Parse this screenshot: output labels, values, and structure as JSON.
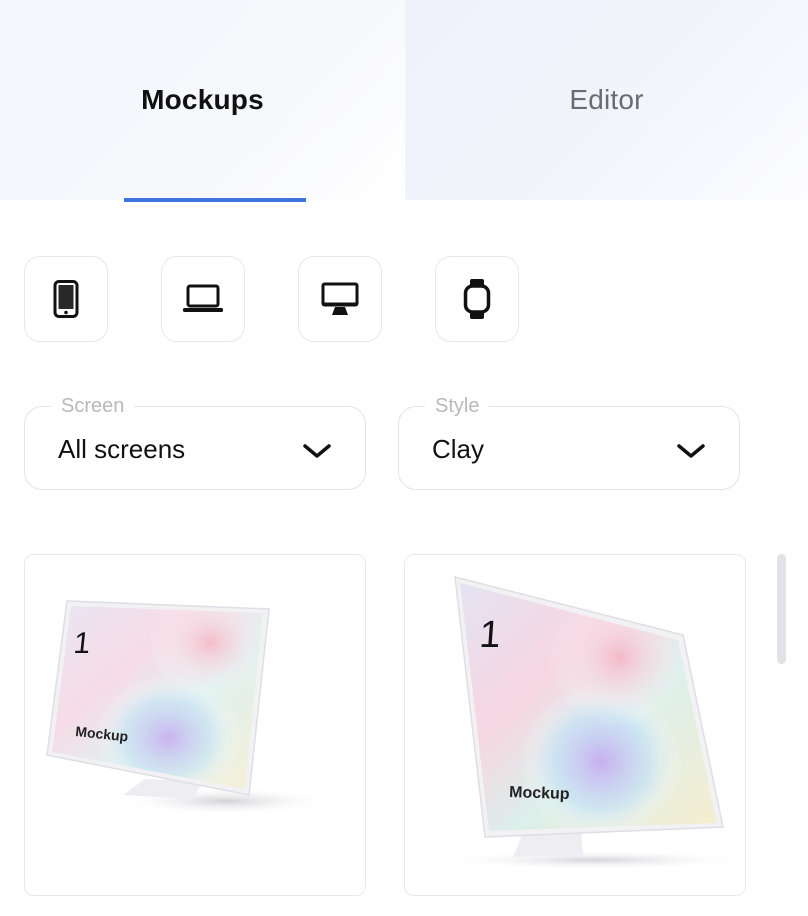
{
  "tabs": [
    {
      "label": "Mockups",
      "active": true
    },
    {
      "label": "Editor",
      "active": false
    }
  ],
  "accent_color": "#3f74e0",
  "devices": [
    {
      "icon": "phone-icon"
    },
    {
      "icon": "laptop-icon"
    },
    {
      "icon": "desktop-icon"
    },
    {
      "icon": "watch-icon"
    }
  ],
  "filters": {
    "screen": {
      "label": "Screen",
      "value": "All screens"
    },
    "style": {
      "label": "Style",
      "value": "Clay"
    }
  },
  "mockups": [
    {
      "number": "1",
      "caption": "Mockup"
    },
    {
      "number": "1",
      "caption": "Mockup"
    }
  ]
}
